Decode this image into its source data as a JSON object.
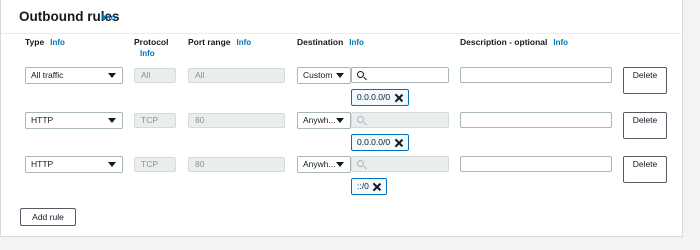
{
  "section": {
    "title": "Outbound rules",
    "info_label": "Info"
  },
  "columns": {
    "type": "Type",
    "protocol": "Protocol",
    "port_range": "Port range",
    "destination": "Destination",
    "description": "Description - optional"
  },
  "rules": [
    {
      "type": "All traffic",
      "protocol": "All",
      "port_range": "All",
      "destination_mode": "Custom",
      "destination_search": "",
      "destination_token": "0.0.0.0/0",
      "description": "",
      "delete_label": "Delete"
    },
    {
      "type": "HTTP",
      "protocol": "TCP",
      "port_range": "80",
      "destination_mode": "Anywh...",
      "destination_search": "",
      "destination_token": "0.0.0.0/0",
      "description": "",
      "delete_label": "Delete"
    },
    {
      "type": "HTTP",
      "protocol": "TCP",
      "port_range": "80",
      "destination_mode": "Anywh...",
      "destination_search": "",
      "destination_token": "::/0",
      "description": "",
      "delete_label": "Delete"
    }
  ],
  "actions": {
    "add_rule_label": "Add rule"
  },
  "colors": {
    "accent": "#0073bb",
    "background": "#f2f3f3",
    "panel": "#ffffff",
    "disabled_field": "#eaeded"
  }
}
